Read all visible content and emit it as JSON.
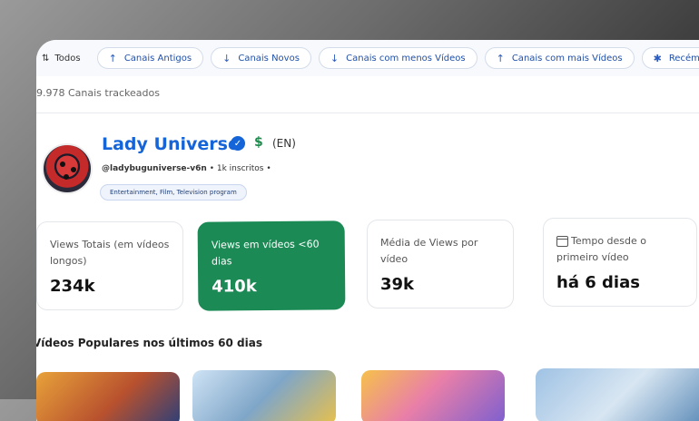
{
  "filters": {
    "all_label": "Todos",
    "chips": [
      {
        "icon": "↑",
        "label": "Canais Antigos"
      },
      {
        "icon": "↓",
        "label": "Canais Novos"
      },
      {
        "icon": "↓",
        "label": "Canais com menos Vídeos"
      },
      {
        "icon": "↑",
        "label": "Canais com mais Vídeos"
      },
      {
        "icon": "✱",
        "label": "Recém Adici"
      }
    ]
  },
  "tracked_count": "9.978 Canais trackeados",
  "channel": {
    "name": "Lady Universe",
    "verified_icon": "✓",
    "monetized_symbol": "$",
    "language": "(EN)",
    "handle": "@ladybuguniverse-v6n",
    "subscribers": "1k inscritos",
    "dot_sep": "•",
    "category": "Entertainment, Film, Television program"
  },
  "stats": [
    {
      "label": "Views Totais (em vídeos longos)",
      "value": "234k"
    },
    {
      "label": "Views em vídeos <60 dias",
      "value": "410k"
    },
    {
      "label": "Média de Views por vídeo",
      "value": "39k"
    },
    {
      "label": "Tempo desde o primeiro vídeo",
      "value": "há 6 dias"
    }
  ],
  "popular_title": "Vídeos Populares nos últimos 60 dias",
  "colors": {
    "accent": "#1565d8",
    "green": "#1b8a55"
  }
}
